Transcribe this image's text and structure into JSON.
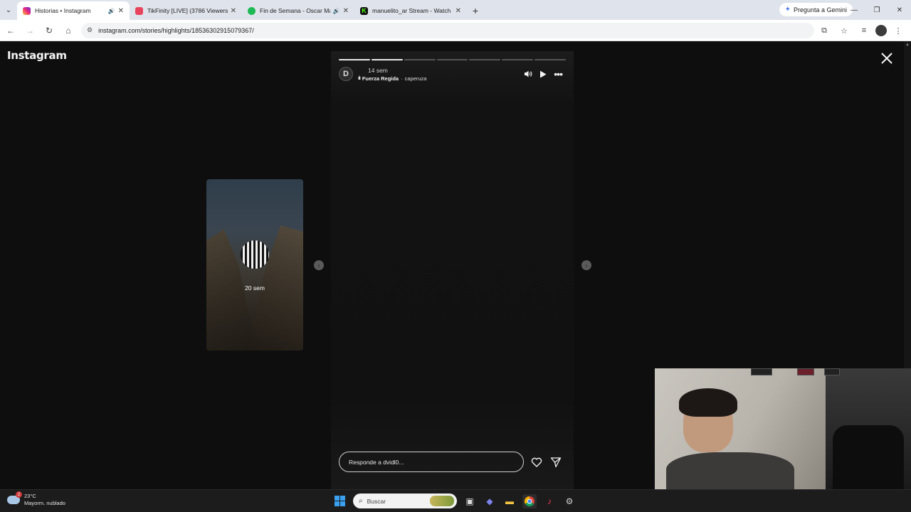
{
  "browser": {
    "tabs": [
      {
        "title": "Historias • Instagram",
        "active": true,
        "favicon_color": "#d62976",
        "has_sound": true
      },
      {
        "title": "TikFinity [LIVE] (3786 Viewers)",
        "active": false,
        "favicon_color": "#e8435c"
      },
      {
        "title": "Fin de Semana - Oscar Maydon",
        "active": false,
        "favicon_color": "#1db954",
        "has_sound": true
      },
      {
        "title": "manuelito_ar Stream - Watch L",
        "active": false,
        "favicon_color": "#53fc18"
      }
    ],
    "gemini_label": "Pregunta a Gemini",
    "url": "instagram.com/stories/highlights/18536302915079367/"
  },
  "page": {
    "logo": "Instagram",
    "prev_story": {
      "time": "20 sem"
    },
    "story": {
      "avatar_letter": "D",
      "time": "14 sem",
      "music_artist": "Fuerza Regida",
      "music_separator": "·",
      "music_title": "caperuza",
      "progress_segments": 7,
      "progress_done": 2,
      "reply_placeholder": "Responde a dvidl0..."
    }
  },
  "taskbar": {
    "weather_badge": "2",
    "weather_temp": "23°C",
    "weather_desc": "Mayorm. nublado",
    "search_placeholder": "Buscar"
  },
  "colors": {
    "page_bg": "#0e0e0e",
    "story_bg": "#121212",
    "accent_instagram": "#d62976"
  }
}
